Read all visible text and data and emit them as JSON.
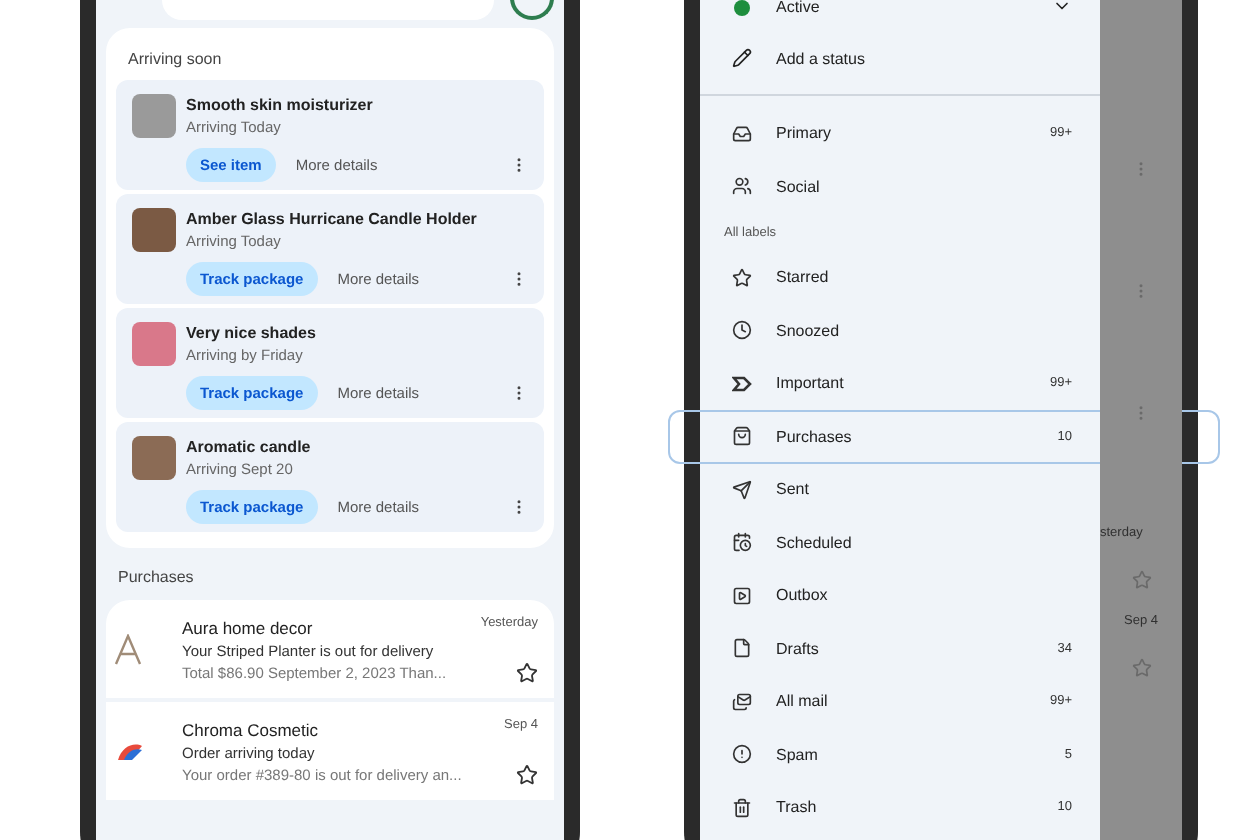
{
  "inbox_phone": {
    "arriving_soon": {
      "title": "Arriving soon",
      "items": [
        {
          "name": "Smooth skin moisturizer",
          "status": "Arriving Today",
          "primary_action": "See item",
          "secondary_action": "More details"
        },
        {
          "name": "Amber Glass Hurricane Candle Holder",
          "status": "Arriving Today",
          "primary_action": "Track package",
          "secondary_action": "More details"
        },
        {
          "name": "Very nice shades",
          "status": "Arriving by Friday",
          "primary_action": "Track package",
          "secondary_action": "More details"
        },
        {
          "name": "Aromatic candle",
          "status": "Arriving Sept 20",
          "primary_action": "Track package",
          "secondary_action": "More details"
        }
      ]
    },
    "purchases": {
      "title": "Purchases",
      "items": [
        {
          "sender": "Aura home decor",
          "subject": "Your Striped Planter is out for delivery",
          "snippet": "Total $86.90 September 2, 2023 Than...",
          "date": "Yesterday",
          "starred": false
        },
        {
          "sender": "Chroma Cosmetic",
          "subject": "Order arriving today",
          "snippet": "Your order #389-80 is out for delivery an...",
          "date": "Sep 4",
          "starred": false
        }
      ]
    }
  },
  "drawer_phone": {
    "status": {
      "label": "Active",
      "color": "#1e8e3e"
    },
    "add_status": "Add a status",
    "primary_items": [
      {
        "kind": "inbox",
        "label": "Primary",
        "count": "99+"
      },
      {
        "kind": "social",
        "label": "Social"
      }
    ],
    "labels_heading": "All labels",
    "label_items": [
      {
        "kind": "star",
        "label": "Starred",
        "highlighted": false
      },
      {
        "kind": "clock",
        "label": "Snoozed",
        "highlighted": false
      },
      {
        "kind": "important",
        "label": "Important",
        "count": "99+",
        "highlighted": false
      },
      {
        "kind": "bag",
        "label": "Purchases",
        "count": "10",
        "highlighted": true
      },
      {
        "kind": "send",
        "label": "Sent",
        "highlighted": false
      },
      {
        "kind": "scheduled",
        "label": "Scheduled",
        "highlighted": false
      },
      {
        "kind": "outbox",
        "label": "Outbox",
        "highlighted": false
      },
      {
        "kind": "file",
        "label": "Drafts",
        "count": "34",
        "highlighted": false
      },
      {
        "kind": "allmail",
        "label": "All mail",
        "count": "99+",
        "highlighted": false
      },
      {
        "kind": "spam",
        "label": "Spam",
        "count": "5",
        "highlighted": false
      },
      {
        "kind": "trash",
        "label": "Trash",
        "count": "10",
        "highlighted": false
      }
    ],
    "background_dates": [
      "sterday",
      "Sep 4"
    ]
  }
}
